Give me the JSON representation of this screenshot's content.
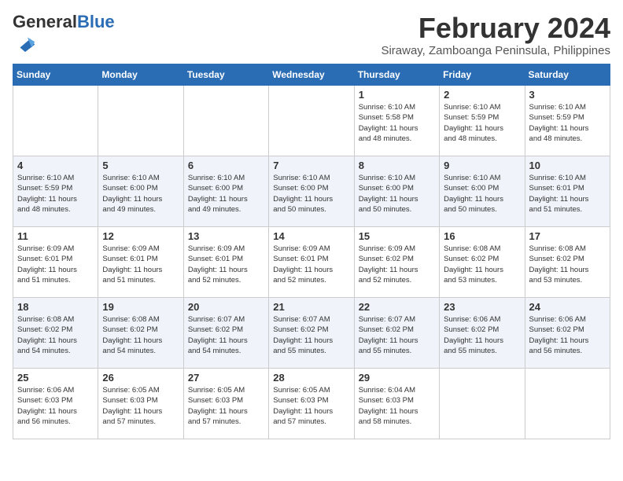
{
  "header": {
    "logo_general": "General",
    "logo_blue": "Blue",
    "month_year": "February 2024",
    "location": "Siraway, Zamboanga Peninsula, Philippines"
  },
  "weekdays": [
    "Sunday",
    "Monday",
    "Tuesday",
    "Wednesday",
    "Thursday",
    "Friday",
    "Saturday"
  ],
  "weeks": [
    [
      {
        "day": "",
        "info": ""
      },
      {
        "day": "",
        "info": ""
      },
      {
        "day": "",
        "info": ""
      },
      {
        "day": "",
        "info": ""
      },
      {
        "day": "1",
        "info": "Sunrise: 6:10 AM\nSunset: 5:58 PM\nDaylight: 11 hours\nand 48 minutes."
      },
      {
        "day": "2",
        "info": "Sunrise: 6:10 AM\nSunset: 5:59 PM\nDaylight: 11 hours\nand 48 minutes."
      },
      {
        "day": "3",
        "info": "Sunrise: 6:10 AM\nSunset: 5:59 PM\nDaylight: 11 hours\nand 48 minutes."
      }
    ],
    [
      {
        "day": "4",
        "info": "Sunrise: 6:10 AM\nSunset: 5:59 PM\nDaylight: 11 hours\nand 48 minutes."
      },
      {
        "day": "5",
        "info": "Sunrise: 6:10 AM\nSunset: 6:00 PM\nDaylight: 11 hours\nand 49 minutes."
      },
      {
        "day": "6",
        "info": "Sunrise: 6:10 AM\nSunset: 6:00 PM\nDaylight: 11 hours\nand 49 minutes."
      },
      {
        "day": "7",
        "info": "Sunrise: 6:10 AM\nSunset: 6:00 PM\nDaylight: 11 hours\nand 50 minutes."
      },
      {
        "day": "8",
        "info": "Sunrise: 6:10 AM\nSunset: 6:00 PM\nDaylight: 11 hours\nand 50 minutes."
      },
      {
        "day": "9",
        "info": "Sunrise: 6:10 AM\nSunset: 6:00 PM\nDaylight: 11 hours\nand 50 minutes."
      },
      {
        "day": "10",
        "info": "Sunrise: 6:10 AM\nSunset: 6:01 PM\nDaylight: 11 hours\nand 51 minutes."
      }
    ],
    [
      {
        "day": "11",
        "info": "Sunrise: 6:09 AM\nSunset: 6:01 PM\nDaylight: 11 hours\nand 51 minutes."
      },
      {
        "day": "12",
        "info": "Sunrise: 6:09 AM\nSunset: 6:01 PM\nDaylight: 11 hours\nand 51 minutes."
      },
      {
        "day": "13",
        "info": "Sunrise: 6:09 AM\nSunset: 6:01 PM\nDaylight: 11 hours\nand 52 minutes."
      },
      {
        "day": "14",
        "info": "Sunrise: 6:09 AM\nSunset: 6:01 PM\nDaylight: 11 hours\nand 52 minutes."
      },
      {
        "day": "15",
        "info": "Sunrise: 6:09 AM\nSunset: 6:02 PM\nDaylight: 11 hours\nand 52 minutes."
      },
      {
        "day": "16",
        "info": "Sunrise: 6:08 AM\nSunset: 6:02 PM\nDaylight: 11 hours\nand 53 minutes."
      },
      {
        "day": "17",
        "info": "Sunrise: 6:08 AM\nSunset: 6:02 PM\nDaylight: 11 hours\nand 53 minutes."
      }
    ],
    [
      {
        "day": "18",
        "info": "Sunrise: 6:08 AM\nSunset: 6:02 PM\nDaylight: 11 hours\nand 54 minutes."
      },
      {
        "day": "19",
        "info": "Sunrise: 6:08 AM\nSunset: 6:02 PM\nDaylight: 11 hours\nand 54 minutes."
      },
      {
        "day": "20",
        "info": "Sunrise: 6:07 AM\nSunset: 6:02 PM\nDaylight: 11 hours\nand 54 minutes."
      },
      {
        "day": "21",
        "info": "Sunrise: 6:07 AM\nSunset: 6:02 PM\nDaylight: 11 hours\nand 55 minutes."
      },
      {
        "day": "22",
        "info": "Sunrise: 6:07 AM\nSunset: 6:02 PM\nDaylight: 11 hours\nand 55 minutes."
      },
      {
        "day": "23",
        "info": "Sunrise: 6:06 AM\nSunset: 6:02 PM\nDaylight: 11 hours\nand 55 minutes."
      },
      {
        "day": "24",
        "info": "Sunrise: 6:06 AM\nSunset: 6:02 PM\nDaylight: 11 hours\nand 56 minutes."
      }
    ],
    [
      {
        "day": "25",
        "info": "Sunrise: 6:06 AM\nSunset: 6:03 PM\nDaylight: 11 hours\nand 56 minutes."
      },
      {
        "day": "26",
        "info": "Sunrise: 6:05 AM\nSunset: 6:03 PM\nDaylight: 11 hours\nand 57 minutes."
      },
      {
        "day": "27",
        "info": "Sunrise: 6:05 AM\nSunset: 6:03 PM\nDaylight: 11 hours\nand 57 minutes."
      },
      {
        "day": "28",
        "info": "Sunrise: 6:05 AM\nSunset: 6:03 PM\nDaylight: 11 hours\nand 57 minutes."
      },
      {
        "day": "29",
        "info": "Sunrise: 6:04 AM\nSunset: 6:03 PM\nDaylight: 11 hours\nand 58 minutes."
      },
      {
        "day": "",
        "info": ""
      },
      {
        "day": "",
        "info": ""
      }
    ]
  ]
}
